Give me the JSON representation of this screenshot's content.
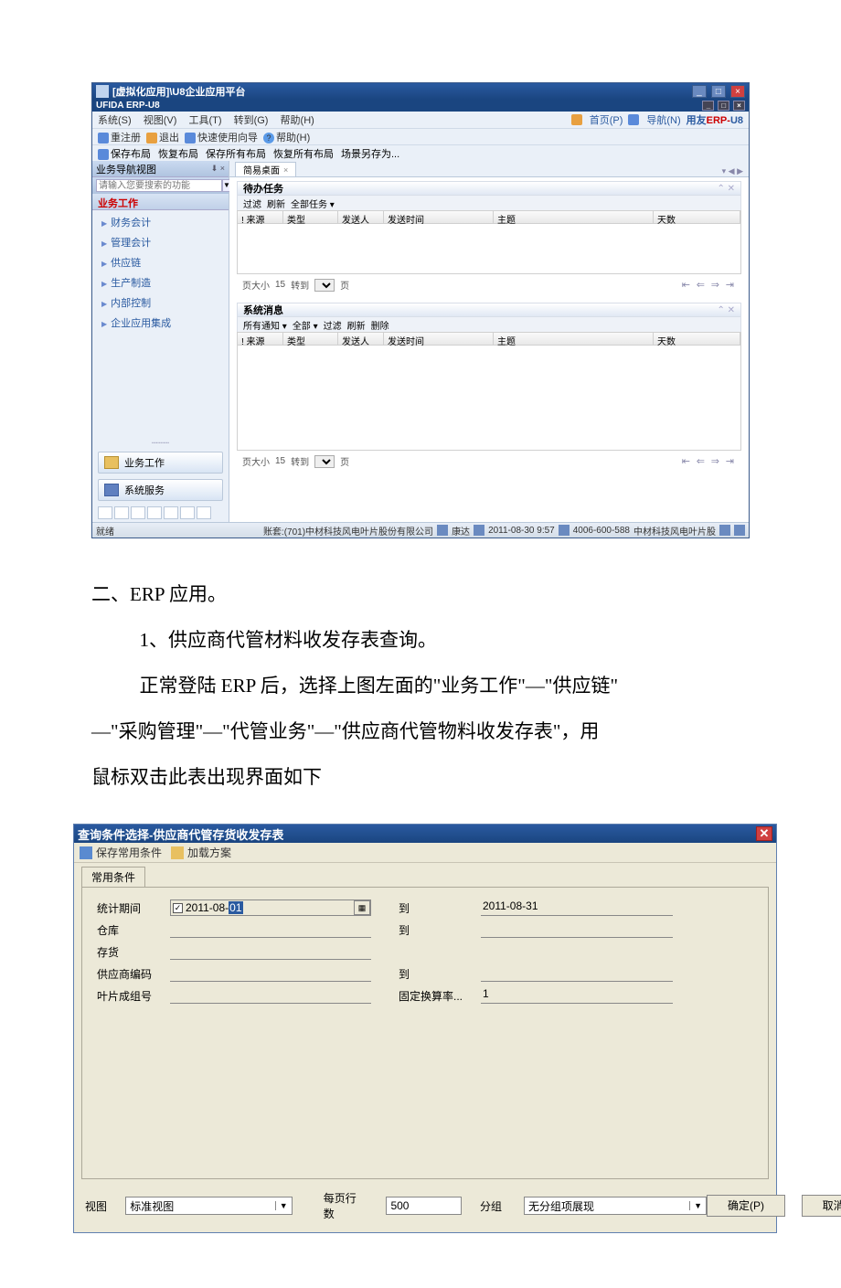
{
  "erp": {
    "title": "[虚拟化应用]\\U8企业应用平台",
    "subtitle": "UFIDA ERP-U8",
    "menu": {
      "system": "系统(S)",
      "view": "视图(V)",
      "tools": "工具(T)",
      "goto": "转到(G)",
      "help": "帮助(H)",
      "home": "首页(P)",
      "nav": "导航(N)",
      "brand_prefix": "用友",
      "brand_erp": "ERP-",
      "brand_u8": "U8"
    },
    "toolbar1": {
      "reregister": "重注册",
      "exit": "退出",
      "guide": "快速使用向导",
      "help": "帮助(H)"
    },
    "toolbar2": {
      "save_layout": "保存布局",
      "restore_layout": "恢复布局",
      "save_all": "保存所有布局",
      "restore_all": "恢复所有布局",
      "scene_save_as": "场景另存为..."
    },
    "sidebar": {
      "header": "业务导航视图",
      "search_placeholder": "请输入您要搜索的功能",
      "section": "业务工作",
      "items": [
        "财务会计",
        "管理会计",
        "供应链",
        "生产制造",
        "内部控制",
        "企业应用集成"
      ],
      "bottom1": "业务工作",
      "bottom2": "系统服务"
    },
    "tab": {
      "label": "简易桌面"
    },
    "panel1": {
      "title": "待办任务",
      "toolbar": {
        "filter": "过滤",
        "refresh": "刷新",
        "all": "全部任务 ▾"
      }
    },
    "panel2": {
      "title": "系统消息",
      "toolbar": {
        "allnotice": "所有通知 ▾",
        "all": "全部 ▾",
        "filter": "过滤",
        "refresh": "刷新",
        "delete": "删除"
      }
    },
    "grid": {
      "src": "! 来源",
      "type": "类型",
      "sender": "发送人",
      "time": "发送时间",
      "subject": "主题",
      "days": "天数"
    },
    "pager": {
      "pagesize_lbl": "页大小",
      "pagesize_val": "15",
      "goto_lbl": "转到",
      "page_lbl": "页"
    },
    "status": {
      "ready": "就绪",
      "acct": "账套:(701)中材科技风电叶片股份有限公司",
      "user": "康达",
      "date": "2011-08-30 9:57",
      "phone": "4006-600-588",
      "company": "中材科技风电叶片股"
    }
  },
  "doc": {
    "heading": "二、ERP 应用。",
    "sub": "1、供应商代管材料收发存表查询。",
    "p1a": "正常登陆 ERP 后，选择上图左面的\"业务工作\"—\"供应链\"",
    "p1b": "—\"采购管理\"—\"代管业务\"—\"供应商代管物料收发存表\"，用",
    "p1c": "鼠标双击此表出现界面如下"
  },
  "dialog": {
    "title": "查询条件选择-供应商代管存货收发存表",
    "toolbar": {
      "save": "保存常用条件",
      "load": "加载方案"
    },
    "tab": "常用条件",
    "labels": {
      "period": "统计期间",
      "warehouse": "仓库",
      "stock": "存货",
      "supplier": "供应商编码",
      "leaf": "叶片成组号",
      "to": "到",
      "rate": "固定换算率...",
      "view": "视图",
      "group": "分组",
      "rows": "每页行数"
    },
    "values": {
      "date_from_prefix": "2011-08-",
      "date_from_day": "01",
      "date_to": "2011-08-31",
      "rate": "1",
      "view": "标准视图",
      "group": "无分组项展现",
      "rows": "500"
    },
    "buttons": {
      "ok": "确定(P)",
      "cancel": "取消(C)"
    }
  }
}
